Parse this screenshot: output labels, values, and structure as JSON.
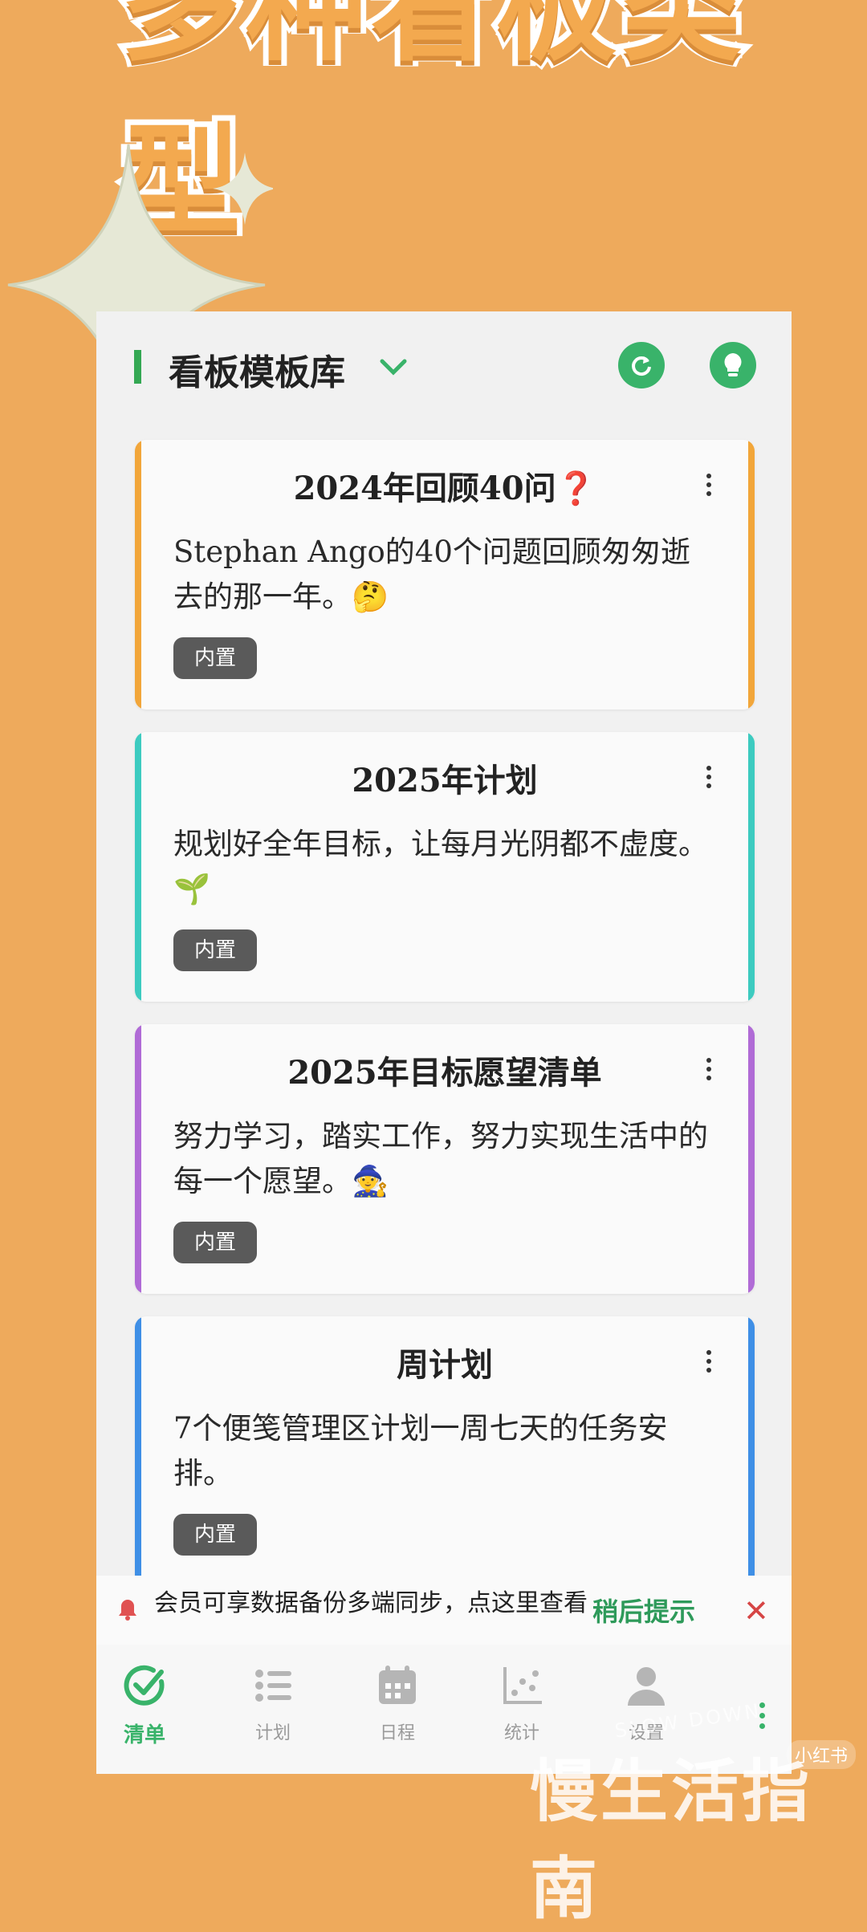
{
  "banner": {
    "text": "多种看板类型"
  },
  "topbar": {
    "title": "看板模板库"
  },
  "cards": [
    {
      "title": "2024年回顾40问❓",
      "desc": "Stephan Ango的40个问题回顾匆匆逝去的那一年。🤔",
      "badge": "内置",
      "color": "#f2a63a"
    },
    {
      "title": "2025年计划",
      "desc": "规划好全年目标，让每月光阴都不虚度。🌱",
      "badge": "内置",
      "color": "#3dcbc0"
    },
    {
      "title": "2025年目标愿望清单",
      "desc": "努力学习，踏实工作，努力实现生活中的每一个愿望。🧙",
      "badge": "内置",
      "color": "#b06bd6"
    },
    {
      "title": "周计划",
      "desc": "7个便笺管理区计划一周七天的任务安排。",
      "badge": "内置",
      "color": "#3f8fe6"
    }
  ],
  "notice": {
    "text": "会员可享数据备份多端同步，点这里查看",
    "later": "稍后提示",
    "close": "✕"
  },
  "tabs": [
    {
      "label": "清单",
      "icon": "check-circle-icon",
      "active": true
    },
    {
      "label": "计划",
      "icon": "list-icon",
      "active": false
    },
    {
      "label": "日程",
      "icon": "calendar-icon",
      "active": false
    },
    {
      "label": "统计",
      "icon": "scatter-icon",
      "active": false
    },
    {
      "label": "设置",
      "icon": "user-icon",
      "active": false
    }
  ],
  "watermark": {
    "text": "慢生活指南",
    "tag": "小红书",
    "slow": "SLOW DOWN"
  },
  "colors": {
    "accent": "#39b36a",
    "background": "#eeaa5c"
  }
}
